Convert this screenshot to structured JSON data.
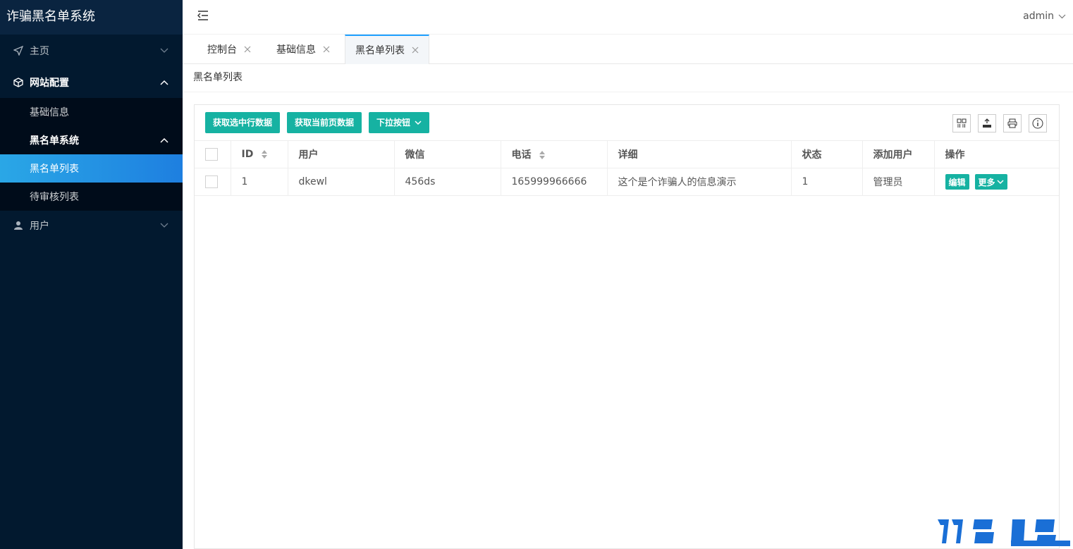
{
  "app": {
    "title": "诈骗黑名单系统"
  },
  "sidebar": {
    "items": [
      {
        "label": "主页",
        "icon": "paper-plane-icon"
      },
      {
        "label": "网站配置",
        "icon": "cube-icon"
      },
      {
        "label": "基础信息"
      },
      {
        "label": "黑名单系统"
      },
      {
        "label": "黑名单列表"
      },
      {
        "label": "待审核列表"
      },
      {
        "label": "用户",
        "icon": "user-icon"
      }
    ]
  },
  "header": {
    "user": "admin"
  },
  "tabs": [
    {
      "label": "控制台"
    },
    {
      "label": "基础信息"
    },
    {
      "label": "黑名单列表"
    }
  ],
  "breadcrumb": "黑名单列表",
  "toolbar": {
    "btn_selected": "获取选中行数据",
    "btn_page": "获取当前页数据",
    "btn_dropdown": "下拉按钮"
  },
  "table": {
    "headers": [
      "ID",
      "用户",
      "微信",
      "电话",
      "详细",
      "状态",
      "添加用户",
      "操作"
    ],
    "rows": [
      {
        "id": "1",
        "user": "dkewl",
        "wechat": "456ds",
        "phone": "165999966666",
        "detail": "这个是个诈骗人的信息演示",
        "status": "1",
        "added_by": "管理员",
        "edit": "编辑",
        "more": "更多"
      }
    ]
  },
  "colors": {
    "sidebar_bg": "#02192f",
    "accent": "#16b2a2",
    "active_item": "#1e9fff"
  }
}
